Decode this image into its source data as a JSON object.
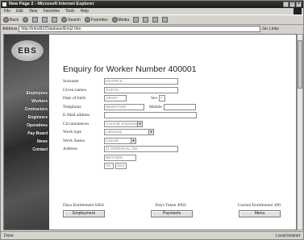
{
  "window": {
    "title": "New Page 2 - Microsoft Internet Explorer"
  },
  "menu": [
    "File",
    "Edit",
    "View",
    "Favorites",
    "Tools",
    "Help"
  ],
  "toolbar": {
    "back": "Back",
    "search": "Search",
    "favorites": "Favorites",
    "media": "Media"
  },
  "address": {
    "label": "Address",
    "value": "http://intraN1/Database/Enq2.htm",
    "go": "Go",
    "links": "Links"
  },
  "sidebar": {
    "logo": "EBS",
    "nav": [
      "Employees",
      "Workers",
      "Contractors",
      "Engineers",
      "Operatives",
      "Pay Board",
      "News",
      "Contact"
    ]
  },
  "page": {
    "title": "Enquiry for Worker Number 400001",
    "fields": {
      "surname": {
        "label": "Surname",
        "value": "KNAPPLE"
      },
      "given_names": {
        "label": "Given names",
        "value": "JUSTIN"
      },
      "dob": {
        "label": "Date of birth",
        "value": "1/9/64F"
      },
      "sex": {
        "label": "Sex",
        "value": "F"
      },
      "telephone": {
        "label": "Telephone",
        "value": "9565077038"
      },
      "mobile": {
        "label": "Mobile",
        "value": ""
      },
      "email": {
        "label": "E-Mail address",
        "value": ""
      },
      "circumstances": {
        "label": "Circumstances",
        "value": "Currently Employed"
      },
      "work_type": {
        "label": "Work type",
        "value": "Labouring"
      },
      "work_status": {
        "label": "Work Status",
        "value": "Casuals"
      },
      "address": {
        "label": "Address",
        "line1": "51 GREENHILL RD",
        "line2": "BRAYNEE",
        "state": "VIC",
        "postcode": "3041"
      }
    },
    "stats": {
      "entitlement": "Days Entitlement 6464",
      "taken": "Days Taken 4964",
      "current": "Current Entitlement 490"
    },
    "buttons": {
      "employment": "Employment",
      "payments": "Payments",
      "menu": "Menu"
    }
  },
  "status": {
    "left": "Done",
    "zone": "Local intranet"
  }
}
